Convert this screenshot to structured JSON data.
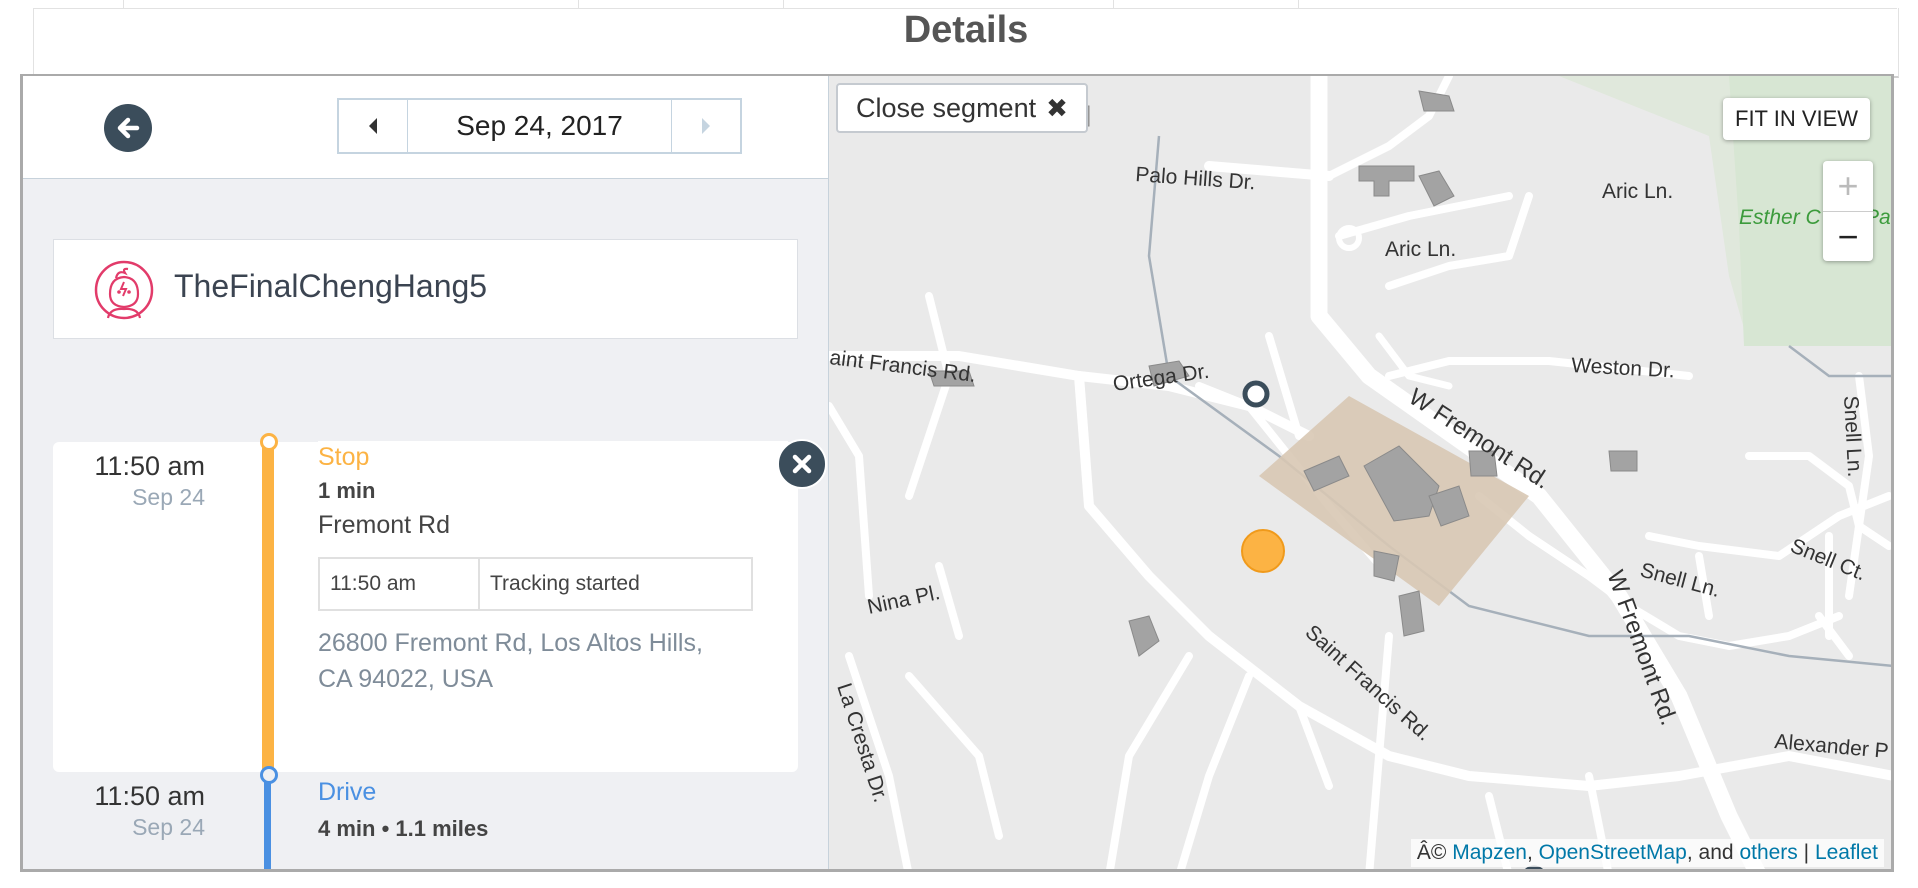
{
  "details": {
    "title": "Details"
  },
  "header": {
    "date": "Sep 24, 2017"
  },
  "user": {
    "name": "TheFinalChengHang5"
  },
  "timeline": {
    "stop": {
      "time": "11:50 am",
      "date": "Sep 24",
      "type": "Stop",
      "duration": "1 min",
      "place": "Fremont Rd",
      "event_time": "11:50 am",
      "event": "Tracking started",
      "address_line1": "26800 Fremont Rd, Los Altos Hills,",
      "address_line2": "CA 94022, USA"
    },
    "drive": {
      "time": "11:50 am",
      "date": "Sep 24",
      "type": "Drive",
      "summary": "4 min • 1.1 miles"
    }
  },
  "map": {
    "close_segment": "Close segment",
    "fit_in_view": "FIT IN VIEW",
    "zoom_in": "+",
    "zoom_out": "−",
    "attribution_prefix": "Â©",
    "attribution_links": [
      "Mapzen",
      "OpenStreetMap",
      "others",
      "Leaflet"
    ],
    "attribution_and": ", and",
    "labels": {
      "palo_hills": "Palo Hills Dr.",
      "aric1": "Aric Ln.",
      "aric2": "Aric Ln.",
      "esther": "Esther C",
      "esther_cut": "Pa",
      "saint_francis_top": "aint Francis Rd.",
      "ortega": "Ortega Dr.",
      "weston": "Weston Dr.",
      "w_fremont1": "W Fremont Rd.",
      "snell_ln_v": "Snell Ln.",
      "nina": "Nina Pl.",
      "snell_ln": "Snell Ln.",
      "snell_ct": "Snell Ct.",
      "saint_francis_bottom": "Saint Francis Rd.",
      "w_fremont2": "W Fremont Rd.",
      "la_cresta": "La Cresta Dr.",
      "alexander": "Alexander P"
    }
  },
  "colors": {
    "stop": "#fcb344",
    "drive": "#4a90e2",
    "dark": "#3b4d5b",
    "link": "#0078a8"
  }
}
